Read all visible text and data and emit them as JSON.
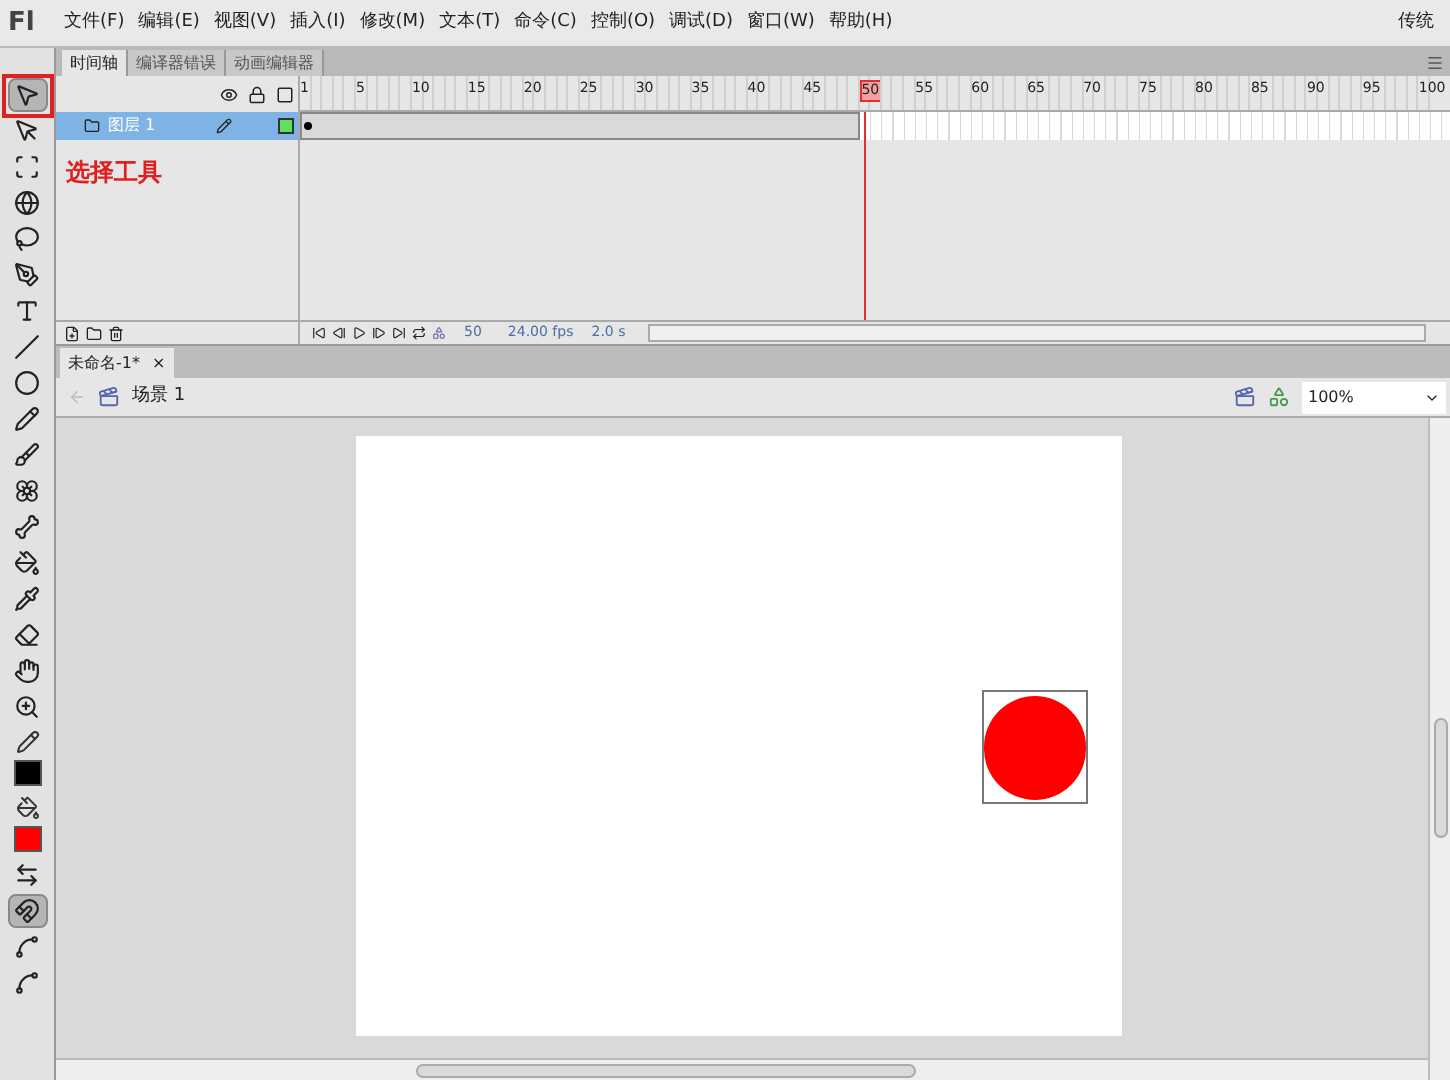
{
  "app_logo": "Fl",
  "menu": [
    "文件(F)",
    "编辑(E)",
    "视图(V)",
    "插入(I)",
    "修改(M)",
    "文本(T)",
    "命令(C)",
    "控制(O)",
    "调试(D)",
    "窗口(W)",
    "帮助(H)"
  ],
  "workspace": "传统",
  "tools": [
    {
      "kind": "selection",
      "selected": true
    },
    {
      "kind": "subselection",
      "selected": false
    },
    {
      "kind": "transform",
      "selected": false
    },
    {
      "kind": "rotate3d",
      "selected": false
    },
    {
      "kind": "lasso",
      "selected": false
    },
    {
      "kind": "pen",
      "selected": false
    },
    {
      "kind": "text",
      "selected": false
    },
    {
      "kind": "line",
      "selected": false
    },
    {
      "kind": "oval",
      "selected": false
    },
    {
      "kind": "pencil",
      "selected": false
    },
    {
      "kind": "brush",
      "selected": false
    },
    {
      "kind": "deco",
      "selected": false
    },
    {
      "kind": "bone",
      "selected": false
    },
    {
      "kind": "bucket",
      "selected": false
    },
    {
      "kind": "eyedropper",
      "selected": false
    },
    {
      "kind": "eraser",
      "selected": false
    },
    {
      "kind": "hand",
      "selected": false
    },
    {
      "kind": "zoom",
      "selected": false
    },
    {
      "kind": "stroke",
      "color": "#000000"
    },
    {
      "kind": "fill",
      "color": "#ff0000"
    },
    {
      "kind": "swap"
    },
    {
      "kind": "snap",
      "selected": true
    },
    {
      "kind": "smooth"
    },
    {
      "kind": "straighten"
    }
  ],
  "annotation": "选择工具",
  "panel_tabs": [
    {
      "label": "时间轴",
      "selected": true
    },
    {
      "label": "编译器错误",
      "selected": false
    },
    {
      "label": "动画编辑器",
      "selected": false
    }
  ],
  "ruler": [
    {
      "label": "1",
      "current": false
    },
    {
      "label": "5",
      "current": false
    },
    {
      "label": "10",
      "current": false
    },
    {
      "label": "15",
      "current": false
    },
    {
      "label": "20",
      "current": false
    },
    {
      "label": "25",
      "current": false
    },
    {
      "label": "30",
      "current": false
    },
    {
      "label": "35",
      "current": false
    },
    {
      "label": "40",
      "current": false
    },
    {
      "label": "45",
      "current": false
    },
    {
      "label": "50",
      "current": true
    },
    {
      "label": "55",
      "current": false
    },
    {
      "label": "60",
      "current": false
    },
    {
      "label": "65",
      "current": false
    },
    {
      "label": "70",
      "current": false
    },
    {
      "label": "75",
      "current": false
    },
    {
      "label": "80",
      "current": false
    },
    {
      "label": "85",
      "current": false
    },
    {
      "label": "90",
      "current": false
    },
    {
      "label": "95",
      "current": false
    },
    {
      "label": "100",
      "current": false
    }
  ],
  "layers": [
    {
      "name": "图层 1",
      "selected": true
    }
  ],
  "timeline_status": {
    "frame": "50",
    "fps": "24.00 fps",
    "time": "2.0 s"
  },
  "document_tabs": [
    {
      "label": "未命名-1*",
      "close": "×",
      "selected": true
    }
  ],
  "scene": "场景 1",
  "zoom": "100%"
}
